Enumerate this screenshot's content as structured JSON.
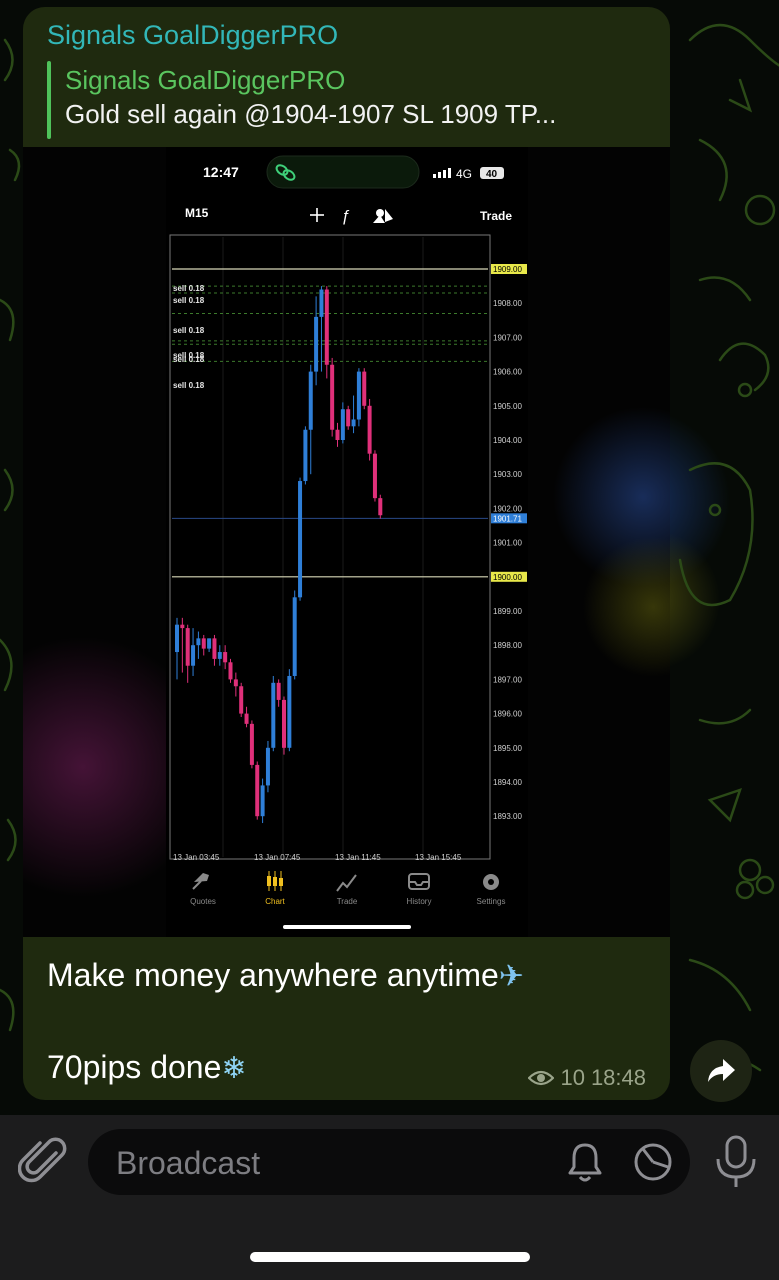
{
  "message": {
    "channel_name": "Signals GoalDiggerPRO",
    "reply": {
      "author": "Signals GoalDiggerPRO",
      "text": "Gold sell again @1904-1907  SL 1909  TP..."
    },
    "caption_line1": "Make money anywhere anytime",
    "caption_emoji1": "✈",
    "caption_line2": "70pips done",
    "caption_emoji2": "❄",
    "views": "10",
    "time": "18:48"
  },
  "screenshot": {
    "status_time": "12:47",
    "network": "4G",
    "battery": "40",
    "timeframe": "M15",
    "trade_label": "Trade",
    "sell_labels": [
      "sell 0.18",
      "sell 0.18",
      "sell 0.18",
      "sell 0.18",
      "sell 0.18",
      "sell 0.18"
    ],
    "tabs": [
      {
        "label": "Quotes",
        "icon": "quotes-icon",
        "active": false
      },
      {
        "label": "Chart",
        "icon": "chart-icon",
        "active": true
      },
      {
        "label": "Trade",
        "icon": "trade-icon",
        "active": false
      },
      {
        "label": "History",
        "icon": "history-icon",
        "active": false
      },
      {
        "label": "Settings",
        "icon": "gear-icon",
        "active": false
      }
    ],
    "highlight_color": "#e8e84a",
    "current_price_color": "#2f7fd8"
  },
  "chart_data": {
    "type": "candlestick",
    "symbol_timeframe": "M15",
    "price_ticks": [
      "1909.00",
      "1908.00",
      "1907.00",
      "1906.00",
      "1905.00",
      "1904.00",
      "1903.00",
      "1902.00",
      "1901.71",
      "1901.00",
      "1900.00",
      "1899.00",
      "1898.00",
      "1897.00",
      "1896.00",
      "1895.00",
      "1894.00",
      "1893.00"
    ],
    "x_ticks": [
      "13 Jan 03:45",
      "13 Jan 07:45",
      "13 Jan 11:45",
      "13 Jan 15:45"
    ],
    "ylim": [
      1892.0,
      1910.0
    ],
    "horizontal_lines": [
      1909.0,
      1900.0
    ],
    "current_price": 1901.71,
    "sell_order_levels": [
      1908.5,
      1908.3,
      1907.7,
      1906.9,
      1906.8,
      1906.3
    ],
    "up_color": "#2f7fd8",
    "down_color": "#e0307a",
    "candles": [
      {
        "o": 1897.8,
        "h": 1898.8,
        "l": 1897.0,
        "c": 1898.6
      },
      {
        "o": 1898.6,
        "h": 1898.8,
        "l": 1897.2,
        "c": 1898.5
      },
      {
        "o": 1898.5,
        "h": 1898.6,
        "l": 1896.9,
        "c": 1897.4
      },
      {
        "o": 1897.4,
        "h": 1898.5,
        "l": 1897.1,
        "c": 1898.0
      },
      {
        "o": 1898.0,
        "h": 1898.4,
        "l": 1897.6,
        "c": 1898.2
      },
      {
        "o": 1898.2,
        "h": 1898.3,
        "l": 1897.7,
        "c": 1897.9
      },
      {
        "o": 1897.9,
        "h": 1898.2,
        "l": 1897.8,
        "c": 1898.2
      },
      {
        "o": 1898.2,
        "h": 1898.3,
        "l": 1897.4,
        "c": 1897.6
      },
      {
        "o": 1897.6,
        "h": 1898.0,
        "l": 1897.4,
        "c": 1897.8
      },
      {
        "o": 1897.8,
        "h": 1898.0,
        "l": 1897.3,
        "c": 1897.5
      },
      {
        "o": 1897.5,
        "h": 1897.6,
        "l": 1896.9,
        "c": 1897.0
      },
      {
        "o": 1897.0,
        "h": 1897.2,
        "l": 1896.5,
        "c": 1896.8
      },
      {
        "o": 1896.8,
        "h": 1896.9,
        "l": 1895.9,
        "c": 1896.0
      },
      {
        "o": 1896.0,
        "h": 1896.2,
        "l": 1895.6,
        "c": 1895.7
      },
      {
        "o": 1895.7,
        "h": 1895.8,
        "l": 1894.4,
        "c": 1894.5
      },
      {
        "o": 1894.5,
        "h": 1894.6,
        "l": 1892.9,
        "c": 1893.0
      },
      {
        "o": 1893.0,
        "h": 1894.1,
        "l": 1892.8,
        "c": 1893.9
      },
      {
        "o": 1893.9,
        "h": 1895.2,
        "l": 1893.7,
        "c": 1895.0
      },
      {
        "o": 1895.0,
        "h": 1897.1,
        "l": 1894.9,
        "c": 1896.9
      },
      {
        "o": 1896.9,
        "h": 1897.0,
        "l": 1896.2,
        "c": 1896.4
      },
      {
        "o": 1896.4,
        "h": 1896.5,
        "l": 1894.8,
        "c": 1895.0
      },
      {
        "o": 1895.0,
        "h": 1897.3,
        "l": 1894.9,
        "c": 1897.1
      },
      {
        "o": 1897.1,
        "h": 1899.6,
        "l": 1897.0,
        "c": 1899.4
      },
      {
        "o": 1899.4,
        "h": 1902.9,
        "l": 1899.3,
        "c": 1902.8
      },
      {
        "o": 1902.8,
        "h": 1904.4,
        "l": 1902.7,
        "c": 1904.3
      },
      {
        "o": 1904.3,
        "h": 1906.2,
        "l": 1903.0,
        "c": 1906.0
      },
      {
        "o": 1906.0,
        "h": 1908.2,
        "l": 1905.6,
        "c": 1907.6
      },
      {
        "o": 1907.6,
        "h": 1908.5,
        "l": 1906.0,
        "c": 1908.4
      },
      {
        "o": 1908.4,
        "h": 1908.5,
        "l": 1905.8,
        "c": 1906.2
      },
      {
        "o": 1906.2,
        "h": 1906.4,
        "l": 1904.1,
        "c": 1904.3
      },
      {
        "o": 1904.3,
        "h": 1904.5,
        "l": 1903.8,
        "c": 1904.0
      },
      {
        "o": 1904.0,
        "h": 1905.1,
        "l": 1903.9,
        "c": 1904.9
      },
      {
        "o": 1904.9,
        "h": 1905.0,
        "l": 1904.3,
        "c": 1904.4
      },
      {
        "o": 1904.4,
        "h": 1905.3,
        "l": 1904.2,
        "c": 1904.6
      },
      {
        "o": 1904.6,
        "h": 1906.1,
        "l": 1904.4,
        "c": 1906.0
      },
      {
        "o": 1906.0,
        "h": 1906.1,
        "l": 1904.9,
        "c": 1905.0
      },
      {
        "o": 1905.0,
        "h": 1905.2,
        "l": 1903.4,
        "c": 1903.6
      },
      {
        "o": 1903.6,
        "h": 1903.7,
        "l": 1902.2,
        "c": 1902.3
      },
      {
        "o": 1902.3,
        "h": 1902.4,
        "l": 1901.7,
        "c": 1901.8
      }
    ]
  },
  "composer": {
    "placeholder": "Broadcast"
  }
}
